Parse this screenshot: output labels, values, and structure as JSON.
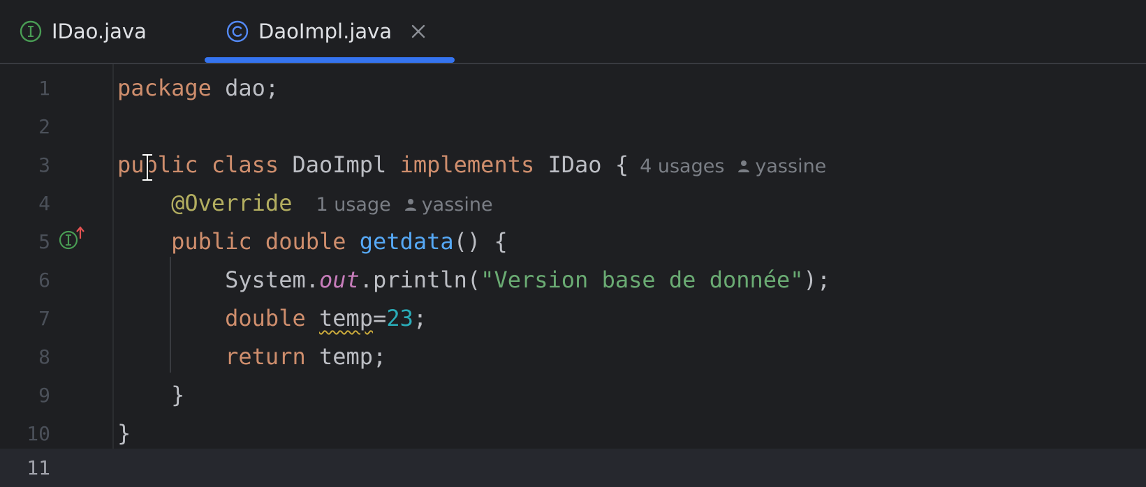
{
  "tabs": [
    {
      "label": "IDao.java",
      "icon": "interface-icon",
      "active": false
    },
    {
      "label": "DaoImpl.java",
      "icon": "class-icon",
      "active": true
    }
  ],
  "colors": {
    "background": "#1e1f22",
    "accent": "#3574f0",
    "keyword": "#cf8e6d",
    "function": "#56a8f5",
    "string": "#6aab73",
    "number": "#2aacb8",
    "annotation": "#b3ae60",
    "field": "#c77dbb",
    "hint": "#7a7e85",
    "interface_icon": "#499c54"
  },
  "editor": {
    "current_line": 11,
    "line_numbers": [
      "1",
      "2",
      "3",
      "4",
      "5",
      "6",
      "7",
      "8",
      "9",
      "10",
      "11"
    ],
    "line1": {
      "kw": "package",
      "rest": " dao;"
    },
    "line3": {
      "kw1": "public",
      "kw2": "class",
      "name": "DaoImpl",
      "kw3": "implements",
      "iface": "IDao",
      "brace": " {",
      "usages": "4 usages",
      "author": "yassine"
    },
    "line4": {
      "annotation": "@Override",
      "usages": "1 usage",
      "author": "yassine"
    },
    "line5": {
      "kw1": "public",
      "kw2": "double",
      "method": "getdata",
      "rest": "() {"
    },
    "line6": {
      "obj": "System.",
      "field": "out",
      "call": ".println(",
      "string": "\"Version base de donnée\"",
      "end": ");"
    },
    "line7": {
      "kw": "double",
      "var": "temp",
      "eq": "=",
      "num": "23",
      "end": ";"
    },
    "line8": {
      "kw": "return",
      "rest": " temp;"
    },
    "line9": {
      "text": "}"
    },
    "line10": {
      "text": "}"
    }
  },
  "gutter": {
    "icon": "implements-interface-icon"
  }
}
